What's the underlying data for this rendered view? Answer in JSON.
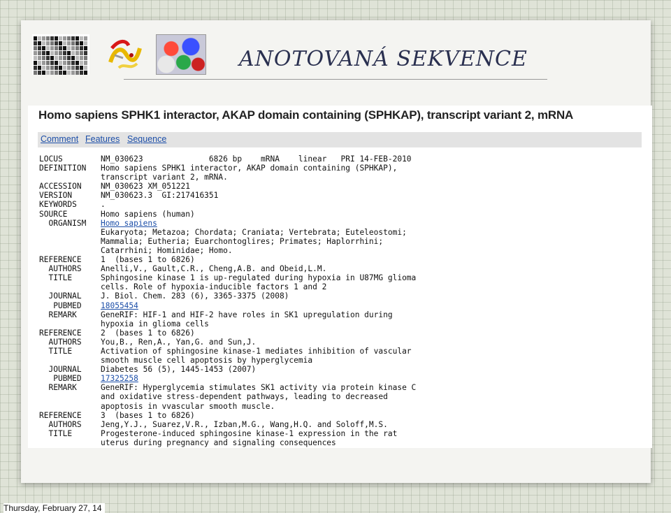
{
  "slide": {
    "title": "ANOTOVANÁ SEKVENCE"
  },
  "record_panel": {
    "heading": "Homo sapiens SPHK1 interactor, AKAP domain containing (SPHKAP), transcript variant 2, mRNA",
    "tabs": [
      "Comment",
      "Features",
      "Sequence"
    ],
    "lines": [
      {
        "key": "LOCUS",
        "value": "NM_030623              6826 bp    mRNA    linear   PRI 14-FEB-2010"
      },
      {
        "key": "DEFINITION",
        "value": "Homo sapiens SPHK1 interactor, AKAP domain containing (SPHKAP),"
      },
      {
        "key": "",
        "value": "transcript variant 2, mRNA."
      },
      {
        "key": "ACCESSION",
        "value": "NM_030623 XM_051221"
      },
      {
        "key": "VERSION",
        "value": "NM_030623.3  GI:217416351"
      },
      {
        "key": "KEYWORDS",
        "value": "."
      },
      {
        "key": "SOURCE",
        "value": "Homo sapiens (human)"
      },
      {
        "key": "  ORGANISM",
        "value": "Homo sapiens",
        "link": true
      },
      {
        "key": "",
        "value": "Eukaryota; Metazoa; Chordata; Craniata; Vertebrata; Euteleostomi;"
      },
      {
        "key": "",
        "value": "Mammalia; Eutheria; Euarchontoglires; Primates; Haplorrhini;"
      },
      {
        "key": "",
        "value": "Catarrhini; Hominidae; Homo."
      },
      {
        "key": "REFERENCE",
        "value": "1  (bases 1 to 6826)"
      },
      {
        "key": "  AUTHORS",
        "value": "Anelli,V., Gault,C.R., Cheng,A.B. and Obeid,L.M."
      },
      {
        "key": "  TITLE",
        "value": "Sphingosine kinase 1 is up-regulated during hypoxia in U87MG glioma"
      },
      {
        "key": "",
        "value": "cells. Role of hypoxia-inducible factors 1 and 2"
      },
      {
        "key": "  JOURNAL",
        "value": "J. Biol. Chem. 283 (6), 3365-3375 (2008)"
      },
      {
        "key": "   PUBMED",
        "value": "18055454",
        "link": true
      },
      {
        "key": "  REMARK",
        "value": "GeneRIF: HIF-1 and HIF-2 have roles in SK1 upregulation during"
      },
      {
        "key": "",
        "value": "hypoxia in glioma cells"
      },
      {
        "key": "REFERENCE",
        "value": "2  (bases 1 to 6826)"
      },
      {
        "key": "  AUTHORS",
        "value": "You,B., Ren,A., Yan,G. and Sun,J."
      },
      {
        "key": "  TITLE",
        "value": "Activation of sphingosine kinase-1 mediates inhibition of vascular"
      },
      {
        "key": "",
        "value": "smooth muscle cell apoptosis by hyperglycemia"
      },
      {
        "key": "  JOURNAL",
        "value": "Diabetes 56 (5), 1445-1453 (2007)"
      },
      {
        "key": "   PUBMED",
        "value": "17325258",
        "link": true
      },
      {
        "key": "  REMARK",
        "value": "GeneRIF: Hyperglycemia stimulates SK1 activity via protein kinase C"
      },
      {
        "key": "",
        "value": "and oxidative stress-dependent pathways, leading to decreased"
      },
      {
        "key": "",
        "value": "apoptosis in vvascular smooth muscle."
      },
      {
        "key": "REFERENCE",
        "value": "3  (bases 1 to 6826)"
      },
      {
        "key": "  AUTHORS",
        "value": "Jeng,Y.J., Suarez,V.R., Izban,M.G., Wang,H.Q. and Soloff,M.S."
      },
      {
        "key": "  TITLE",
        "value": "Progesterone-induced sphingosine kinase-1 expression in the rat"
      },
      {
        "key": "",
        "value": "uterus during pregnancy and signaling consequences"
      }
    ]
  },
  "footer": {
    "date": "Thursday, February 27, 14"
  }
}
